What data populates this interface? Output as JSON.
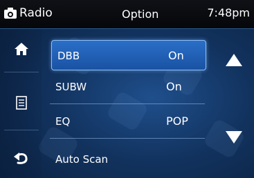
{
  "header": {
    "title": "Radio",
    "screen": "Option",
    "time": "7:48pm"
  },
  "sidebar": {
    "icons": [
      "home-icon",
      "list-icon",
      "back-icon"
    ]
  },
  "options": [
    {
      "label": "DBB",
      "value": "On",
      "selected": true
    },
    {
      "label": "SUBW",
      "value": "On",
      "selected": false
    },
    {
      "label": "EQ",
      "value": "POP",
      "selected": false
    },
    {
      "label": "Auto Scan",
      "value": "",
      "selected": false
    }
  ],
  "colors": {
    "accent": "#1f63bf",
    "background": "#12335f",
    "header": "#05070a"
  }
}
